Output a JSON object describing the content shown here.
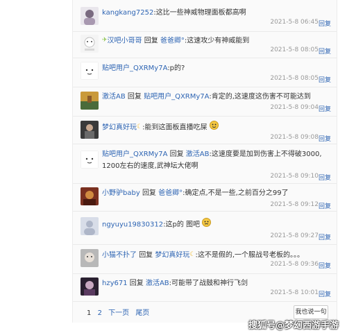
{
  "reply_word": "回复",
  "separator": ":",
  "comments": [
    {
      "user": "kangkang7252",
      "reply_to": "",
      "text": "这比一些神威物理面板都高啊",
      "time": "2021-5-8 06:45",
      "action": "回复"
    },
    {
      "user": "汉吧小哥哥",
      "reply_to": "爸爸卿°",
      "text": "这速攻少有神威能到",
      "time": "2021-5-8 08:05",
      "action": "回复"
    },
    {
      "user": "贴吧用户_QXRMy7A",
      "reply_to": "",
      "text": "p的?",
      "time": "2021-5-8 08:05",
      "action": "回复"
    },
    {
      "user": "激活AB",
      "reply_to": "贴吧用户_QXRMy7A",
      "text": "肯定的,这速度这伤害不可能达到",
      "time": "2021-5-8 09:04",
      "action": "回复"
    },
    {
      "user": "梦幻真好玩",
      "reply_to": "",
      "text": "能到这面板直播吃屎",
      "time": "2021-5-8 09:08",
      "action": "回复"
    },
    {
      "user": "贴吧用户_QXRMy7A",
      "reply_to": "激活AB",
      "text": "这速度要是加到伤害上不得破3000, 1200左右的速度,武神坛大佬啊",
      "time": "2021-5-8 09:10",
      "action": "回复"
    },
    {
      "user": "小野驴baby",
      "reply_to": "爸爸卿°",
      "text": "确定点,不是一些,之前百分之99了",
      "time": "2021-5-8 09:12",
      "action": "回复"
    },
    {
      "user": "ngyuyu19830312",
      "reply_to": "",
      "text": "这p的 图吧",
      "time": "2021-5-8 09:27",
      "action": "回复"
    },
    {
      "user": "小猫不扑了",
      "reply_to": "梦幻真好玩",
      "text": "这不是假的,一个服战号老板的。。。",
      "time": "2021-5-8 09:36",
      "action": "回复"
    },
    {
      "user": "hzy671",
      "reply_to": "激活AB",
      "text": "可能带了战鼓和神行飞剑",
      "time": "2021-5-8 10:01",
      "action": "回复"
    }
  ],
  "pagination": {
    "pages": [
      "1",
      "2"
    ],
    "next": "下一页",
    "last": "尾页"
  },
  "say_button": "我也说一句",
  "watermark": "搜狐号@梦幻西游手游",
  "colors": {
    "link": "#2d64b3",
    "time": "#999999",
    "panel": "#fafafa"
  }
}
